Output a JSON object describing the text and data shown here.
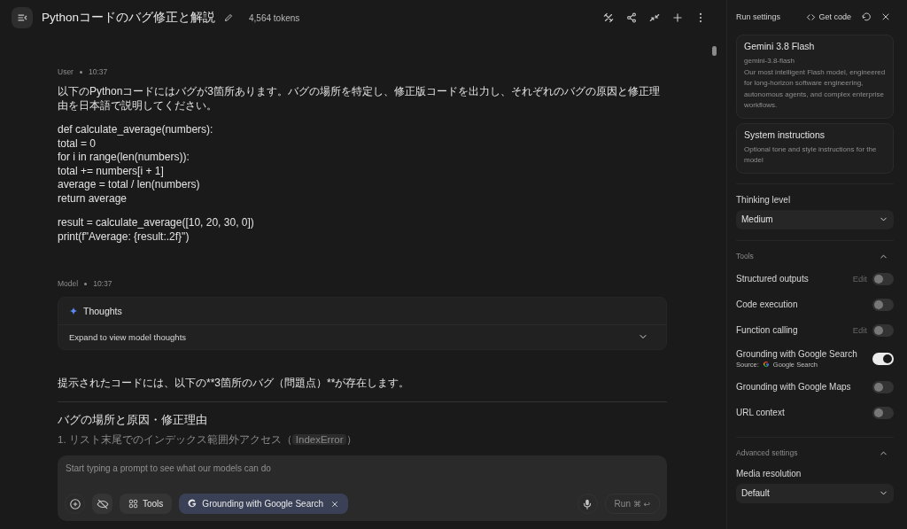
{
  "header": {
    "title": "Pythonコードのバグ修正と解説",
    "tokens": "4,564 tokens"
  },
  "messages": [
    {
      "role": "User",
      "time": "10:37",
      "blocks": [
        {
          "kind": "text",
          "text": "以下のPythonコードにはバグが3箇所あります。バグの場所を特定し、修正版コードを出力し、それぞれのバグの原因と修正理由を日本語で説明してください。"
        },
        {
          "kind": "text",
          "text": "def calculate_average(numbers):\ntotal = 0\nfor i in range(len(numbers)):\ntotal += numbers[i + 1]\naverage = total / len(numbers)\nreturn average"
        },
        {
          "kind": "text",
          "text": "result = calculate_average([10, 20, 30, 0])\nprint(f\"Average: {result:.2f}\")"
        }
      ]
    },
    {
      "role": "Model",
      "time": "10:37",
      "blocks": [
        {
          "kind": "thoughts",
          "title": "Thoughts",
          "text": "Expand to view model thoughts",
          "expanded": false
        },
        {
          "kind": "text",
          "text": "提示されたコードには、以下の**3箇所のバグ（問題点）**が存在します。"
        },
        {
          "kind": "rule"
        },
        {
          "kind": "heading",
          "text": "バグの場所と原因・修正理由"
        },
        {
          "kind": "faded",
          "text": "1. リスト末尾でのインデックス範囲外アクセス（",
          "code": "IndexError",
          "after": "）"
        }
      ]
    }
  ],
  "composer": {
    "placeholder": "Start typing a prompt to see what our models can do",
    "tools_label": "Tools",
    "chips": [
      {
        "label": "Grounding with Google Search"
      }
    ],
    "run": {
      "label": "Run",
      "shortcut": "⌘ ↩",
      "disabled": true
    }
  },
  "settings": {
    "title": "Run settings",
    "get_code": "Get code",
    "model": {
      "name": "Gemini 3.8 Flash",
      "id": "gemini-3.8-flash",
      "description": "Our most intelligent Flash model, engineered for long-horizon software engineering, autonomous agents, and complex enterprise workflows."
    },
    "system": {
      "title": "System instructions",
      "hint": "Optional tone and style instructions for the model"
    },
    "thinking": {
      "label": "Thinking level",
      "value": "Medium"
    },
    "tools": {
      "title": "Tools",
      "expanded": true,
      "items": [
        {
          "label": "Structured outputs",
          "edit": "Edit",
          "on": false
        },
        {
          "label": "Code execution",
          "on": false
        },
        {
          "label": "Function calling",
          "edit": "Edit",
          "on": false
        },
        {
          "label": "Grounding with Google Search",
          "on": true,
          "source_label": "Source:",
          "source": "Google Search"
        },
        {
          "label": "Grounding with Google Maps",
          "on": false
        },
        {
          "label": "URL context",
          "on": false
        }
      ]
    },
    "advanced": {
      "title": "Advanced settings",
      "expanded": true,
      "media": {
        "label": "Media resolution",
        "value": "Default"
      }
    }
  }
}
